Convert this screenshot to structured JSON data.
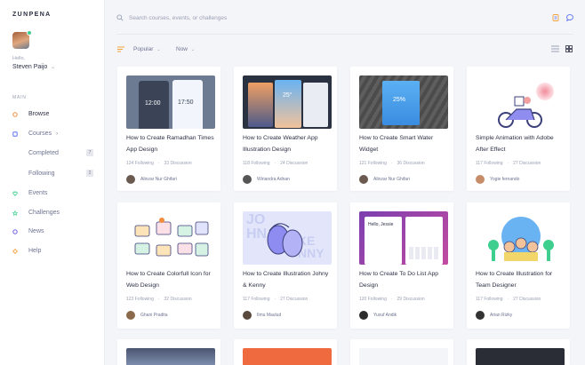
{
  "sidebar": {
    "brand": "ZUNPENA",
    "hello": "Hello,",
    "user_name": "Steven Paijo",
    "section_label": "MAIN",
    "items": [
      {
        "label": "Browse",
        "icon": "circle-icon",
        "color": "#f28b3b"
      },
      {
        "label": "Courses",
        "icon": "square-icon",
        "color": "#5b6ff0",
        "chevron": "›"
      },
      {
        "label": "Events",
        "icon": "heart-icon",
        "color": "#3ecf8e"
      },
      {
        "label": "Challenges",
        "icon": "star-icon",
        "color": "#3ecf8e"
      },
      {
        "label": "News",
        "icon": "ring-icon",
        "color": "#6b5bf0"
      },
      {
        "label": "Help",
        "icon": "diamond-icon",
        "color": "#f2a23b"
      }
    ],
    "courses_sub": [
      {
        "label": "Completed",
        "count": "7"
      },
      {
        "label": "Following",
        "count": "2"
      }
    ]
  },
  "header": {
    "search_placeholder": "Search courses, events, or challenges"
  },
  "filters": {
    "sort": "Popular",
    "time": "Now"
  },
  "cards": [
    {
      "title": "How to Create Ramadhan Times App Design",
      "following": "124 Following",
      "discussion": "33 Discussion",
      "author": "Alinzar Nur Ghifari"
    },
    {
      "title": "How to Create Weather App Illustration Design",
      "following": "118 Following",
      "discussion": "24 Discussion",
      "author": "Wiriandra Adnan"
    },
    {
      "title": "How to Create Smart Water Widget",
      "following": "121 Following",
      "discussion": "36 Discussion",
      "author": "Alinzar Nur Ghifari"
    },
    {
      "title": "Simple Animation with Adobe After Effect",
      "following": "117 Following",
      "discussion": "27 Discussion",
      "author": "Yogie fernando"
    },
    {
      "title": "How to Create Colorfull Icon for Web Design",
      "following": "123 Following",
      "discussion": "32 Discussion",
      "author": "Ghani Pradita"
    },
    {
      "title": "How to Create Illustration Johny & Kenny",
      "following": "117 Following",
      "discussion": "27 Discussion",
      "author": "Ilmu Maulud"
    },
    {
      "title": "How to Create To Do List App Design",
      "following": "120 Following",
      "discussion": "29 Discussion",
      "author": "Yuxuf Andik"
    },
    {
      "title": "How to Create Illustration for Team Designer",
      "following": "117 Following",
      "discussion": "27 Discussion",
      "author": "Arian Rizky"
    }
  ],
  "thumb_text": {
    "card1": [
      "12:00",
      "17:50"
    ],
    "card2": "25°",
    "card3": "25%",
    "card6": [
      "JO",
      "HN",
      "KE",
      "NNY"
    ],
    "card7": "Hello, Jessie"
  }
}
